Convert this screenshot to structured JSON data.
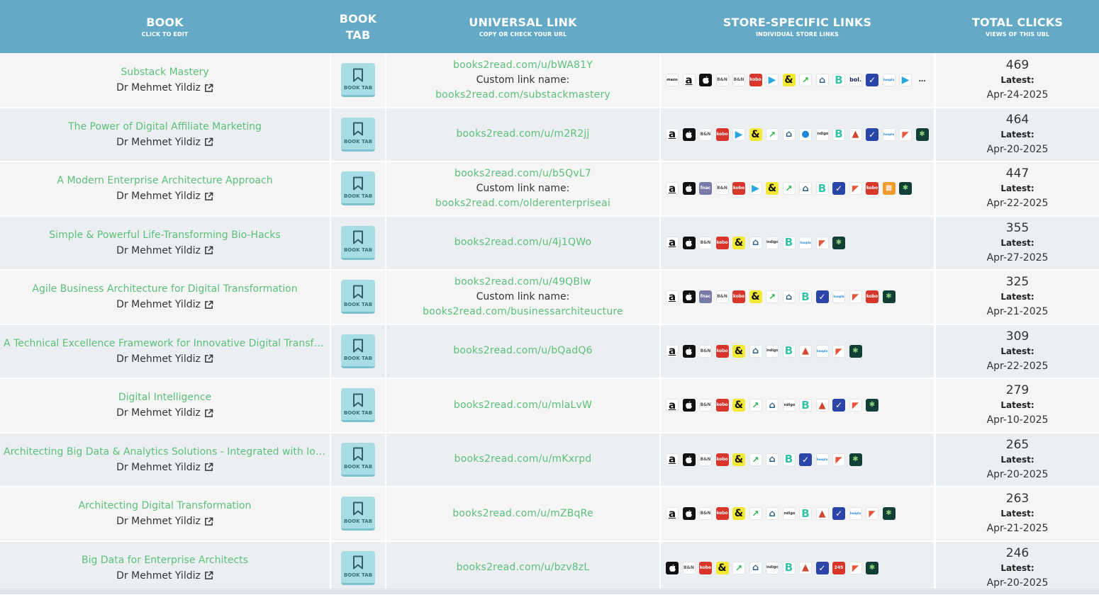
{
  "header": {
    "book": {
      "title": "BOOK",
      "sub": "CLICK TO EDIT"
    },
    "book_tab": {
      "line1": "BOOK",
      "line2": "TAB"
    },
    "universal": {
      "title": "UNIVERSAL LINK",
      "sub": "COPY OR CHECK YOUR URL"
    },
    "store": {
      "title": "STORE-SPECIFIC LINKS",
      "sub": "INDIVIDUAL STORE LINKS"
    },
    "clicks": {
      "title": "TOTAL CLICKS",
      "sub": "VIEWS OF THIS UBL"
    }
  },
  "labels": {
    "book_tab": "BOOK TAB",
    "custom_link": "Custom link name:",
    "latest": "Latest:"
  },
  "rows": [
    {
      "title": "Substack Mastery",
      "author": "Dr Mehmet Yildiz",
      "link": "books2read.com/u/bWA81Y",
      "custom": "books2read.com/substackmastery",
      "clicks": "469",
      "date": "Apr-24-2025",
      "stores": [
        "amazon-text",
        "amazon",
        "apple",
        "barnes-noble",
        "barnes-noble",
        "kobo",
        "google-play",
        "ampersand",
        "thalia",
        "library",
        "bookbeat",
        "bol",
        "vivlio",
        "hoopla",
        "google-play",
        "more"
      ]
    },
    {
      "title": "The Power of Digital Affiliate Marketing",
      "author": "Dr Mehmet Yildiz",
      "link": "books2read.com/u/m2R2jj",
      "custom": "",
      "clicks": "464",
      "date": "Apr-20-2025",
      "stores": [
        "amazon",
        "apple",
        "barnes-noble",
        "kobo",
        "google-play",
        "ampersand",
        "thalia",
        "library",
        "bolde",
        "indigo",
        "bookbeat",
        "adlibris",
        "vivlio",
        "hoopla",
        "palace",
        "everand"
      ]
    },
    {
      "title": "A Modern Enterprise Architecture Approach",
      "author": "Dr Mehmet Yildiz",
      "link": "books2read.com/u/b5QvL7",
      "custom": "books2read.com/olderenterpriseai",
      "clicks": "447",
      "date": "Apr-22-2025",
      "stores": [
        "amazon",
        "apple",
        "fnac",
        "barnes-noble",
        "kobo",
        "google-play",
        "ampersand",
        "thalia",
        "library",
        "bookbeat",
        "vivlio",
        "palace",
        "kobo",
        "orange",
        "everand"
      ]
    },
    {
      "title": "Simple & Powerful Life-Transforming Bio-Hacks",
      "author": "Dr Mehmet Yildiz",
      "link": "books2read.com/u/4j1QWo",
      "custom": "",
      "clicks": "355",
      "date": "Apr-27-2025",
      "stores": [
        "amazon",
        "apple",
        "barnes-noble",
        "kobo",
        "ampersand",
        "library",
        "indigo",
        "bookbeat",
        "hoopla",
        "palace",
        "everand"
      ]
    },
    {
      "title": "Agile Business Architecture for Digital Transformation",
      "author": "Dr Mehmet Yildiz",
      "link": "books2read.com/u/49QBlw",
      "custom": "books2read.com/businessarchiteucture",
      "clicks": "325",
      "date": "Apr-21-2025",
      "stores": [
        "amazon",
        "apple",
        "fnac",
        "barnes-noble",
        "kobo",
        "ampersand",
        "thalia",
        "library",
        "bookbeat",
        "vivlio",
        "hoopla",
        "palace",
        "kobo",
        "everand"
      ]
    },
    {
      "title": "A Technical Excellence Framework for Innovative Digital Transform...",
      "author": "Dr Mehmet Yildiz",
      "link": "books2read.com/u/bQadQ6",
      "custom": "",
      "clicks": "309",
      "date": "Apr-22-2025",
      "stores": [
        "amazon",
        "apple",
        "barnes-noble",
        "kobo",
        "ampersand",
        "library",
        "indigo",
        "bookbeat",
        "adlibris",
        "hoopla",
        "palace",
        "everand"
      ]
    },
    {
      "title": "Digital Intelligence",
      "author": "Dr Mehmet Yildiz",
      "link": "books2read.com/u/mlaLvW",
      "custom": "",
      "clicks": "279",
      "date": "Apr-10-2025",
      "stores": [
        "amazon",
        "apple",
        "barnes-noble",
        "kobo",
        "ampersand",
        "thalia",
        "library",
        "indigo",
        "bookbeat",
        "adlibris",
        "vivlio",
        "palace",
        "everand"
      ]
    },
    {
      "title": "Architecting Big Data & Analytics Solutions - Integrated with IoT & ...",
      "author": "Dr Mehmet Yildiz",
      "link": "books2read.com/u/mKxrpd",
      "custom": "",
      "clicks": "265",
      "date": "Apr-20-2025",
      "stores": [
        "amazon",
        "apple",
        "barnes-noble",
        "kobo",
        "ampersand",
        "thalia",
        "library",
        "bookbeat",
        "vivlio",
        "hoopla",
        "palace",
        "everand"
      ]
    },
    {
      "title": "Architecting Digital Transformation",
      "author": "Dr Mehmet Yildiz",
      "link": "books2read.com/u/mZBqRe",
      "custom": "",
      "clicks": "263",
      "date": "Apr-21-2025",
      "stores": [
        "amazon",
        "apple",
        "barnes-noble",
        "kobo",
        "ampersand",
        "thalia",
        "library",
        "indigo",
        "bookbeat",
        "adlibris",
        "vivlio",
        "hoopla",
        "palace",
        "everand"
      ]
    },
    {
      "title": "Big Data for Enterprise Architects",
      "author": "Dr Mehmet Yildiz",
      "link": "books2read.com/u/bzv8zL",
      "custom": "",
      "clicks": "246",
      "date": "Apr-20-2025",
      "stores": [
        "apple",
        "barnes-noble",
        "kobo",
        "ampersand",
        "thalia",
        "library",
        "indigo",
        "bookbeat",
        "adlibris",
        "vivlio",
        "24symbols",
        "palace",
        "everand"
      ]
    }
  ],
  "colors": {
    "header": "#64aac6",
    "link": "#5cc07a",
    "booktab": "#a9dde6"
  }
}
